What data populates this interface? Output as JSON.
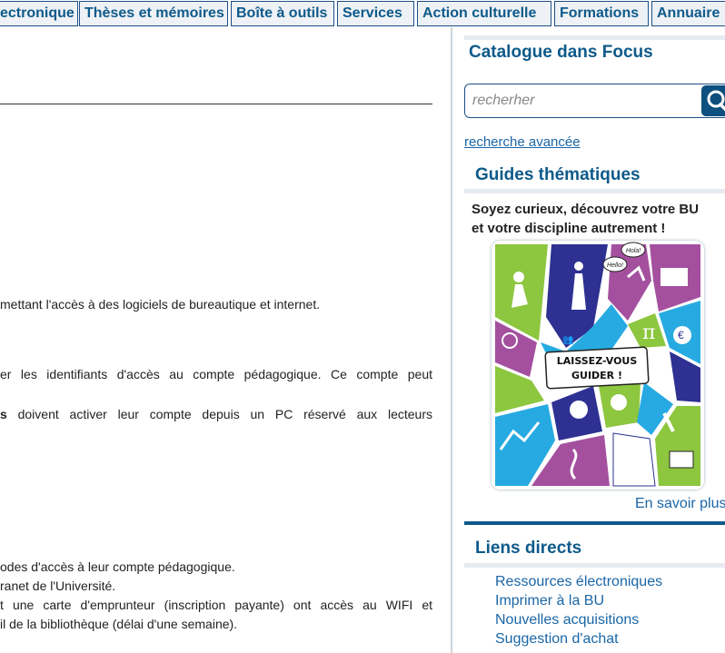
{
  "nav": {
    "tabs": [
      "ectronique",
      "Thèses et mémoires",
      "Boîte à outils",
      "Services",
      "Action culturelle",
      "Formations",
      "Annuaire"
    ]
  },
  "main": {
    "para1": "mettant l'accès à des logiciels de bureautique et internet.",
    "para2": "er les identifiants d'accès au compte pédagogique. Ce compte peut",
    "para3_bold": "s",
    "para3": " doivent activer leur compte depuis un PC réservé aux lecteurs",
    "list": [
      "odes d'accès à leur compte pédagogique.",
      "ranet de l'Université.",
      "t une carte d'emprunteur (inscription payante) ont accès au WIFI et",
      "il de la bibliothèque (délai d'une semaine)."
    ]
  },
  "sidebar": {
    "catalogue_title": "Catalogue dans Focus",
    "search_placeholder": "recherher",
    "advanced_link": "recherche avancée",
    "guides_title": "Guides thématiques",
    "promo_line1": "Soyez curieux, découvrez votre BU",
    "promo_line2": "et votre discipline autrement !",
    "poster": {
      "banner_line1": "LAISSEZ-VOUS",
      "banner_line2": "GUIDER !",
      "bubble1": "Hola!",
      "bubble2": "Hello!",
      "colors": [
        "#8dc63f",
        "#27aae1",
        "#2e3192",
        "#a4509f",
        "#ffffff"
      ]
    },
    "more_link": "En savoir plus",
    "direct_title": "Liens directs",
    "direct_links": [
      "Ressources électroniques",
      "Imprimer à la BU",
      "Nouvelles acquisitions",
      "Suggestion d'achat"
    ],
    "search_icon": "magnifier-icon"
  },
  "colors": {
    "brand": "#0e5a8a",
    "link": "#1a66a6",
    "nav_border": "#1c4f86"
  }
}
